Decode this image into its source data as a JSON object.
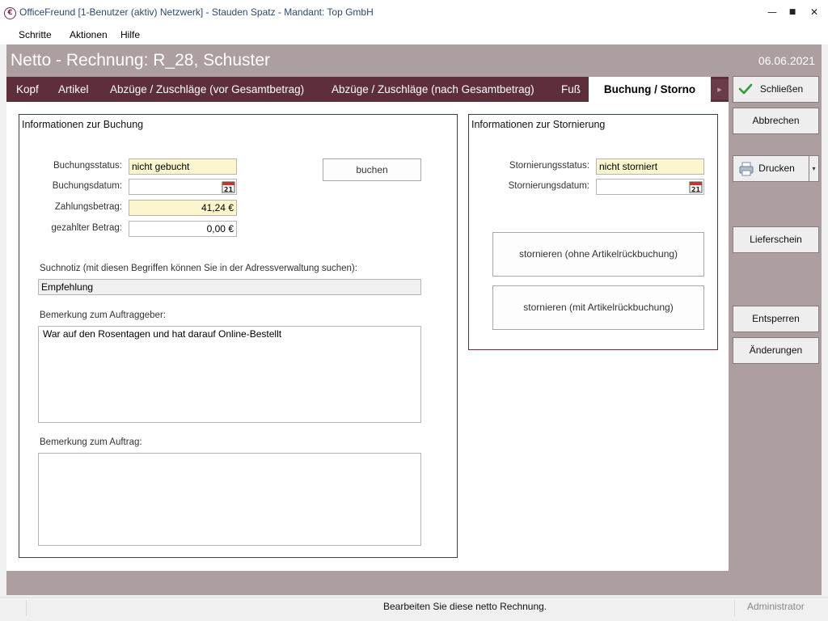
{
  "window": {
    "title": "OfficeFreund [1-Benutzer (aktiv) Netzwerk]  -  Stauden Spatz  -  Mandant: Top GmbH",
    "icon": "euro-icon",
    "minimize": "—",
    "maximize": "■",
    "close": "✕"
  },
  "menu": [
    "Schritte",
    "Aktionen",
    "Hilfe"
  ],
  "header": {
    "title": "Netto - Rechnung: R_28, Schuster",
    "date": "06.06.2021"
  },
  "tabs": [
    {
      "label": "Kopf",
      "active": false
    },
    {
      "label": "Artikel",
      "active": false
    },
    {
      "label": "Abzüge / Zuschläge (vor Gesamtbetrag)",
      "active": false
    },
    {
      "label": "Abzüge / Zuschläge (nach Gesamtbetrag)",
      "active": false
    },
    {
      "label": "Fuß",
      "active": false
    },
    {
      "label": "Buchung / Storno",
      "active": true
    }
  ],
  "tab_scroll": "▸",
  "sidebar": {
    "close": "Schließen",
    "cancel": "Abbrechen",
    "print": "Drucken",
    "print_dropdown": "▾",
    "delivery_note": "Lieferschein",
    "unlock": "Entsperren",
    "changes": "Änderungen"
  },
  "booking": {
    "title": "Informationen zur Buchung",
    "status_label": "Buchungsstatus:",
    "status_value": "nicht gebucht",
    "date_label": "Buchungsdatum:",
    "date_value": "",
    "amount_label": "Zahlungsbetrag:",
    "amount_value": "41,24 €",
    "paid_label": "gezahlter Betrag:",
    "paid_value": "0,00 €",
    "book_button": "buchen",
    "search_note_label": "Suchnotiz (mit diesen Begriffen können Sie in der Adressverwaltung suchen):",
    "search_note_value": "Empfehlung",
    "client_remark_label": "Bemerkung zum Auftraggeber:",
    "client_remark_value": "War auf den Rosentagen und hat darauf Online-Bestellt",
    "order_remark_label": "Bemerkung zum Auftrag:",
    "order_remark_value": ""
  },
  "cancellation": {
    "title": "Informationen zur Stornierung",
    "status_label": "Stornierungsstatus:",
    "status_value": "nicht storniert",
    "date_label": "Stornierungsdatum:",
    "date_value": "",
    "cancel_without_button": "stornieren (ohne Artikelrückbuchung)",
    "cancel_with_button": "stornieren (mit Artikelrückbuchung)"
  },
  "status": {
    "message": "Bearbeiten Sie diese netto Rechnung.",
    "user": "Administrator"
  },
  "colors": {
    "accent_dark": "#5e2e3b",
    "accent_light": "#ad9e9f",
    "highlight_field": "#fcf6cf"
  }
}
